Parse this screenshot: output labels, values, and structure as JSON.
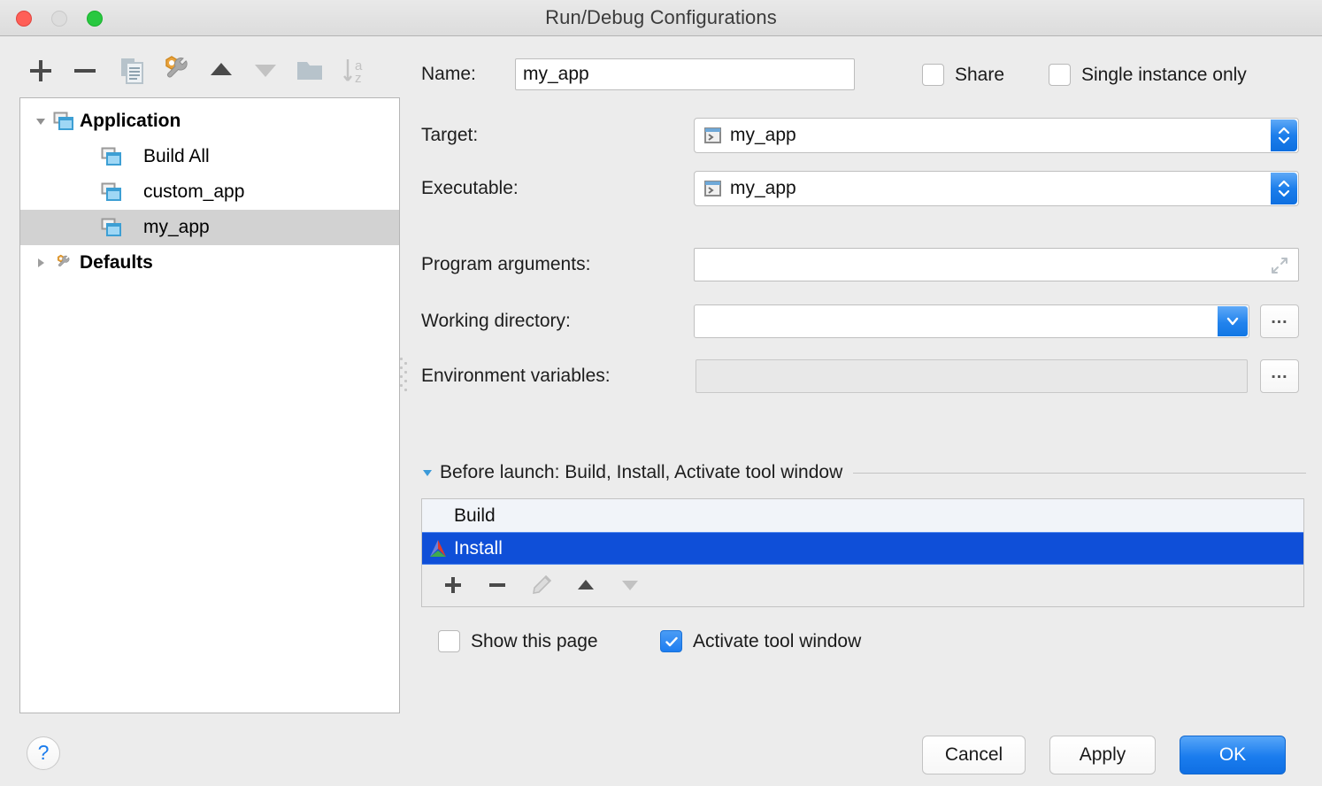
{
  "window": {
    "title": "Run/Debug Configurations",
    "controls": [
      "close",
      "minimize",
      "maximize"
    ]
  },
  "left_toolbar": {
    "buttons": [
      {
        "name": "add-button",
        "icon": "plus-icon",
        "enabled": true
      },
      {
        "name": "remove-button",
        "icon": "minus-icon",
        "enabled": true
      },
      {
        "name": "copy-button",
        "icon": "copy-icon",
        "enabled": true
      },
      {
        "name": "edit-defaults-button",
        "icon": "wrench-icon",
        "enabled": true
      },
      {
        "name": "move-up-button",
        "icon": "triangle-up-icon",
        "enabled": true
      },
      {
        "name": "move-down-button",
        "icon": "triangle-down-icon",
        "enabled": false
      },
      {
        "name": "new-folder-button",
        "icon": "folder-icon",
        "enabled": true
      },
      {
        "name": "sort-button",
        "icon": "sort-az-icon",
        "enabled": false
      }
    ]
  },
  "tree": {
    "items": [
      {
        "label": "Application",
        "icon": "application-icon",
        "twisty": "expanded",
        "depth": 0,
        "bold": true,
        "selected": false
      },
      {
        "label": "Build All",
        "icon": "application-icon",
        "twisty": "none",
        "depth": 1,
        "bold": false,
        "selected": false
      },
      {
        "label": "custom_app",
        "icon": "application-icon",
        "twisty": "none",
        "depth": 1,
        "bold": false,
        "selected": false
      },
      {
        "label": "my_app",
        "icon": "application-icon",
        "twisty": "none",
        "depth": 1,
        "bold": false,
        "selected": true
      },
      {
        "label": "Defaults",
        "icon": "wrench-icon",
        "twisty": "collapsed",
        "depth": 0,
        "bold": true,
        "selected": false
      }
    ]
  },
  "form": {
    "name_label": "Name:",
    "name_value": "my_app",
    "share_label": "Share",
    "share_checked": false,
    "single_instance_label": "Single instance only",
    "single_instance_checked": false,
    "target_label": "Target:",
    "target_value": "my_app",
    "target_icon": "console-app-icon",
    "executable_label": "Executable:",
    "executable_value": "my_app",
    "executable_icon": "console-app-icon",
    "program_arguments_label": "Program arguments:",
    "program_arguments_value": "",
    "program_arguments_expand_icon": "expand-arrows-icon",
    "working_directory_label": "Working directory:",
    "working_directory_value": "",
    "working_directory_browse": "…",
    "environment_variables_label": "Environment variables:",
    "environment_variables_value": "",
    "environment_variables_enabled": false,
    "environment_variables_browse": "…"
  },
  "before_launch": {
    "twisty": "expanded",
    "title": "Before launch: Build, Install, Activate tool window",
    "tasks": [
      {
        "label": "Build",
        "icon": null,
        "selected": false
      },
      {
        "label": "Install",
        "icon": "cmake-icon",
        "selected": true
      }
    ],
    "toolbar": [
      {
        "name": "add-task-button",
        "icon": "plus-icon",
        "enabled": true
      },
      {
        "name": "remove-task-button",
        "icon": "minus-icon",
        "enabled": true
      },
      {
        "name": "edit-task-button",
        "icon": "pencil-icon",
        "enabled": false
      },
      {
        "name": "move-task-up-button",
        "icon": "triangle-up-icon",
        "enabled": true
      },
      {
        "name": "move-task-down-button",
        "icon": "triangle-down-icon",
        "enabled": false
      }
    ],
    "show_page_label": "Show this page",
    "show_page_checked": false,
    "activate_tool_window_label": "Activate tool window",
    "activate_tool_window_checked": true
  },
  "footer": {
    "help_label": "?",
    "cancel_label": "Cancel",
    "apply_label": "Apply",
    "ok_label": "OK"
  },
  "colors": {
    "window_bg": "#ececec",
    "accent_blue": "#1a7cee",
    "selection_blue": "#0f4fd8",
    "tree_selection_gray": "#d2d2d2",
    "border_gray": "#c3c3c3"
  }
}
